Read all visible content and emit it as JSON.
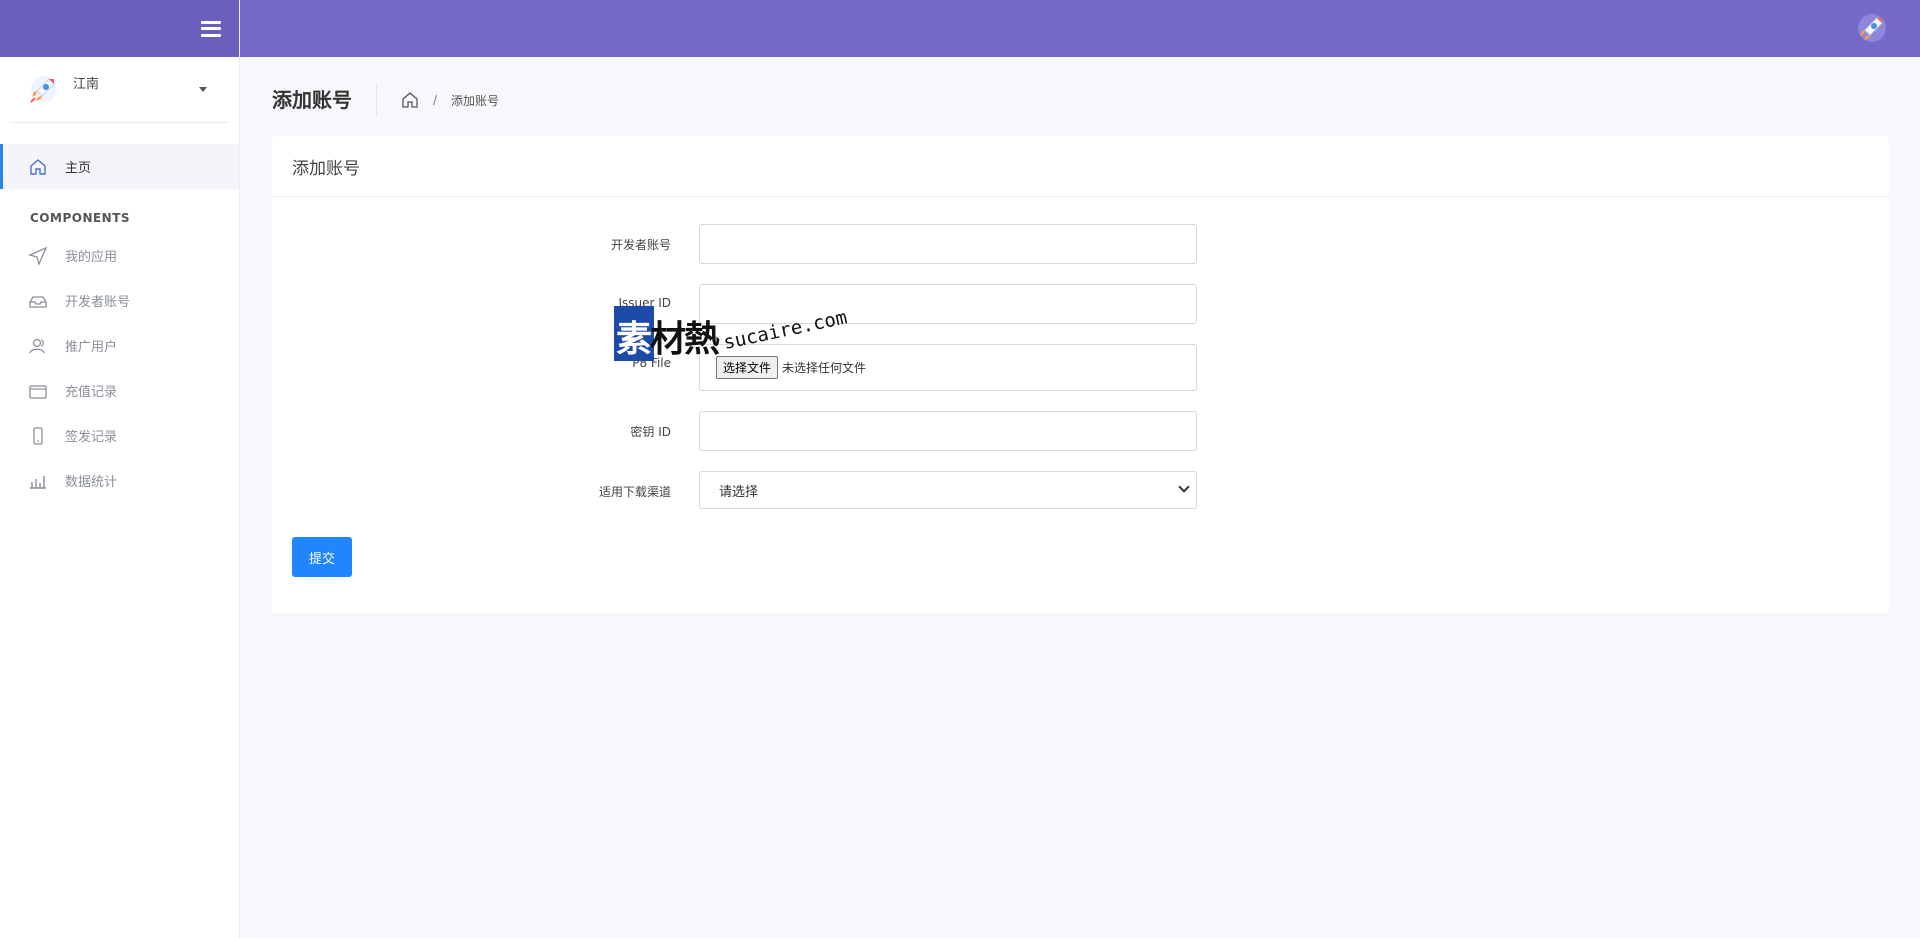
{
  "sidebar": {
    "user": {
      "name": "江南"
    },
    "nav": {
      "home": "主页",
      "section": "COMPONENTS",
      "items": [
        "我的应用",
        "开发者账号",
        "推广用户",
        "充值记录",
        "签发记录",
        "数据统计"
      ]
    }
  },
  "page": {
    "title": "添加账号",
    "breadcrumb_current": "添加账号",
    "breadcrumb_sep": "/"
  },
  "card": {
    "title": "添加账号",
    "form": {
      "developer_account_label": "开发者账号",
      "issuer_id_label": "Issuer ID",
      "p8_file_label": "P8 File",
      "file_button": "选择文件",
      "file_status": "未选择任何文件",
      "key_id_label": "密钥 ID",
      "channel_label": "适用下载渠道",
      "channel_value": "请选择",
      "submit": "提交"
    }
  },
  "watermark": {
    "cn": "素材熱",
    "cn_first": "素",
    "en": "sucaire.com"
  },
  "colors": {
    "topbar": "#7369c9",
    "accent": "#1f86ff",
    "active_bar": "#2f80ed"
  }
}
